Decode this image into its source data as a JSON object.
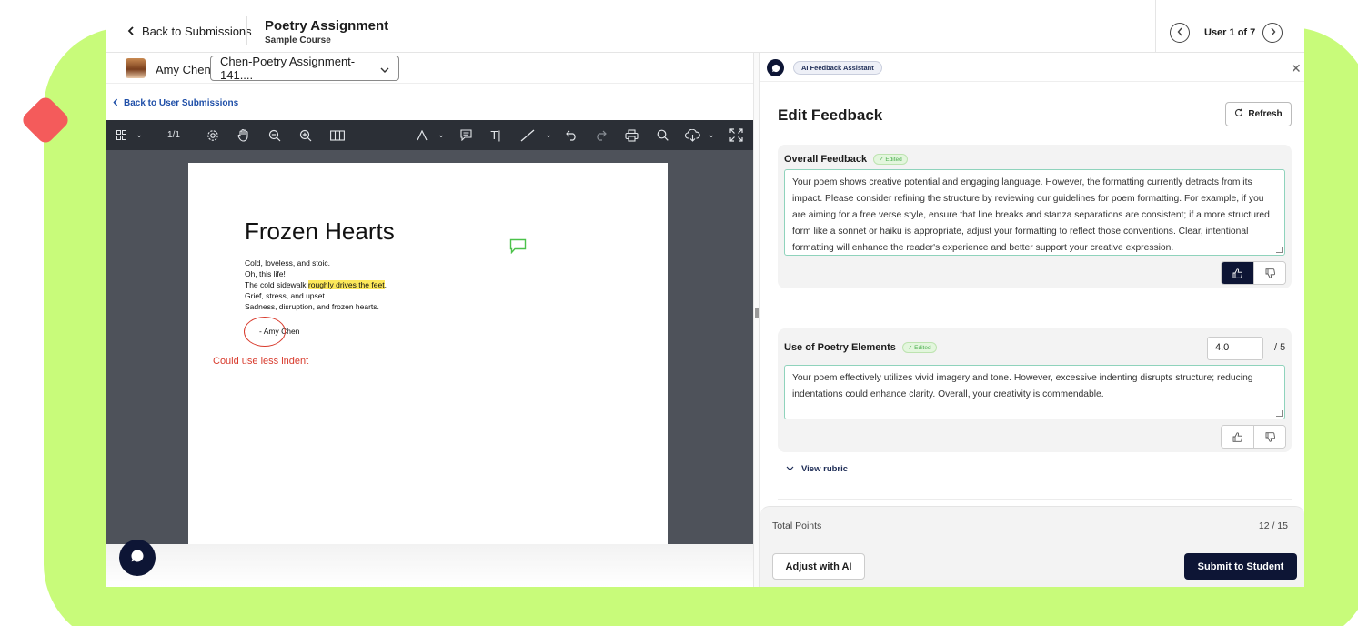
{
  "header": {
    "back_label": "Back to Submissions",
    "title": "Poetry Assignment",
    "subtitle": "Sample Course",
    "user_counter": "User 1 of 7"
  },
  "student": {
    "name": "Amy Chen",
    "submission_select": "Chen-Poetry Assignment-141...."
  },
  "left": {
    "back_user_label": "Back to User Submissions",
    "page_indicator": "1/1"
  },
  "document": {
    "title": "Frozen Hearts",
    "line1": "Cold, loveless, and stoic.",
    "line2": "Oh, this life!",
    "line3_pre": "The cold sidewalk ",
    "line3_highlight": "roughly drives the feet",
    "line3_post": ".",
    "line4": "Grief, stress, and upset.",
    "line5": "Sadness, disruption, and frozen hearts.",
    "signature": "-   Amy Chen",
    "annotation": "Could use less indent"
  },
  "ai_panel": {
    "pill": "AI Feedback Assistant",
    "edit_title": "Edit Feedback",
    "refresh_label": "Refresh",
    "overall": {
      "label": "Overall Feedback",
      "badge": "✓ Edited",
      "text": "Your poem shows creative potential and engaging language. However, the formatting currently detracts from its impact. Please consider refining the structure by reviewing our guidelines for poem formatting. For example, if you are aiming for a free verse style, ensure that line breaks and stanza separations are consistent; if a more structured form like a sonnet or haiku is appropriate, adjust your formatting to reflect those conventions. Clear, intentional formatting will enhance the reader's experience and better support your creative expression."
    },
    "elements": {
      "label": "Use of Poetry Elements",
      "badge": "✓ Edited",
      "score": "4.0",
      "max": "/ 5",
      "text": "Your poem effectively utilizes vivid imagery and tone. However, excessive indenting disrupts structure; reducing indentations could enhance clarity. Overall, your creativity is commendable."
    },
    "rubric_label": "View rubric",
    "total_label": "Total Points",
    "total_value": "12 / 15",
    "adjust_label": "Adjust with AI",
    "submit_label": "Submit to Student"
  },
  "colors": {
    "accent_navy": "#0d1535",
    "backdrop_green": "#c8fb7a",
    "backdrop_red": "#f45b5b",
    "annotation_red": "#d83a2c",
    "highlight_yellow": "#fde85a"
  }
}
